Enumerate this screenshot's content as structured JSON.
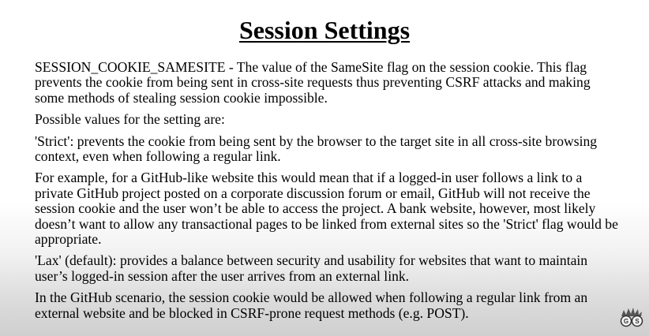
{
  "slide": {
    "title": "Session Settings",
    "paragraphs": [
      "SESSION_COOKIE_SAMESITE - The value of the SameSite flag on the session cookie. This flag prevents the cookie from being sent in cross-site requests thus preventing CSRF attacks and making some methods of stealing session cookie impossible.",
      "Possible values for the setting are:",
      "'Strict': prevents the cookie from being sent by the browser to the target site in all cross-site browsing context, even when following a regular link.",
      "For example, for a GitHub-like website this would mean that if a logged-in user follows a link to a private GitHub project posted on a corporate discussion forum or email, GitHub will not receive the session cookie and the user won’t be able to access the project. A bank website, however, most likely doesn’t want to allow any transactional pages to be linked from external sites so the 'Strict' flag would be appropriate.",
      "'Lax' (default): provides a balance between security and usability for websites that want to maintain user’s logged-in session after the user arrives from an external link.",
      "In the GitHub scenario, the session cookie would be allowed when following a regular link from an external website and be blocked in CSRF-prone request methods (e.g. POST)."
    ]
  },
  "logo": {
    "letters": [
      "G",
      "S"
    ],
    "icon": "hedgehog-glasses-logo"
  }
}
